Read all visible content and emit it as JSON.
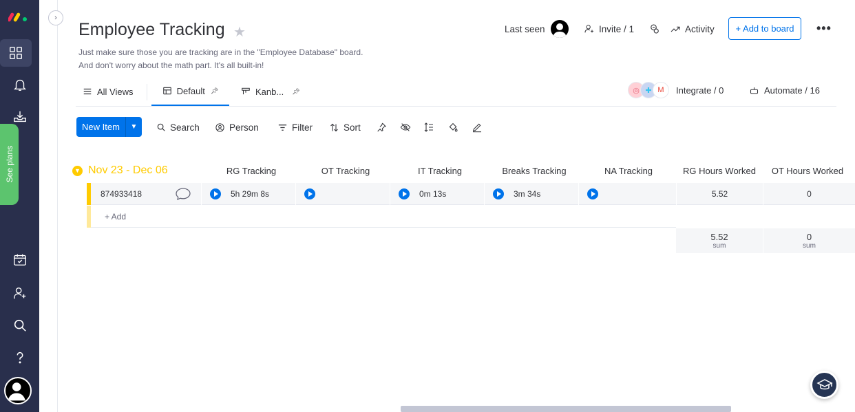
{
  "board": {
    "title": "Employee Tracking",
    "description_line1": "Just make sure those you are tracking are in the \"Employee Database\" board.",
    "description_line2": "And don't worry about the math part. It's all built-in!"
  },
  "header": {
    "last_seen": "Last seen",
    "invite": "Invite / 1",
    "activity": "Activity",
    "add_to_board": "+ Add to board",
    "more": "•••"
  },
  "views": {
    "all_views": "All Views",
    "default": "Default",
    "kanban": "Kanb...",
    "integrate": "Integrate / 0",
    "automate": "Automate / 16"
  },
  "sidebar": {
    "see_plans": "See plans"
  },
  "toolbar": {
    "new_item": "New Item",
    "search": "Search",
    "person": "Person",
    "filter": "Filter",
    "sort": "Sort"
  },
  "group": {
    "name": "Nov 23 - Dec 06",
    "columns": [
      "RG Tracking",
      "OT Tracking",
      "IT Tracking",
      "Breaks Tracking",
      "NA Tracking",
      "RG Hours Worked",
      "OT Hours Worked"
    ],
    "rows": [
      {
        "name": "874933418",
        "rg_tracking": "5h 29m 8s",
        "ot_tracking": "",
        "it_tracking": "0m 13s",
        "breaks_tracking": "3m 34s",
        "na_tracking": "",
        "rg_hours": "5.52",
        "ot_hours": "0"
      }
    ],
    "add_label": "+ Add",
    "sums": {
      "rg_hours": "5.52",
      "ot_hours": "0",
      "label": "sum"
    }
  },
  "colors": {
    "primary": "#0073ea",
    "group": "#ffcb00",
    "rail": "#292f4c",
    "see_plans": "#5cc46e"
  }
}
